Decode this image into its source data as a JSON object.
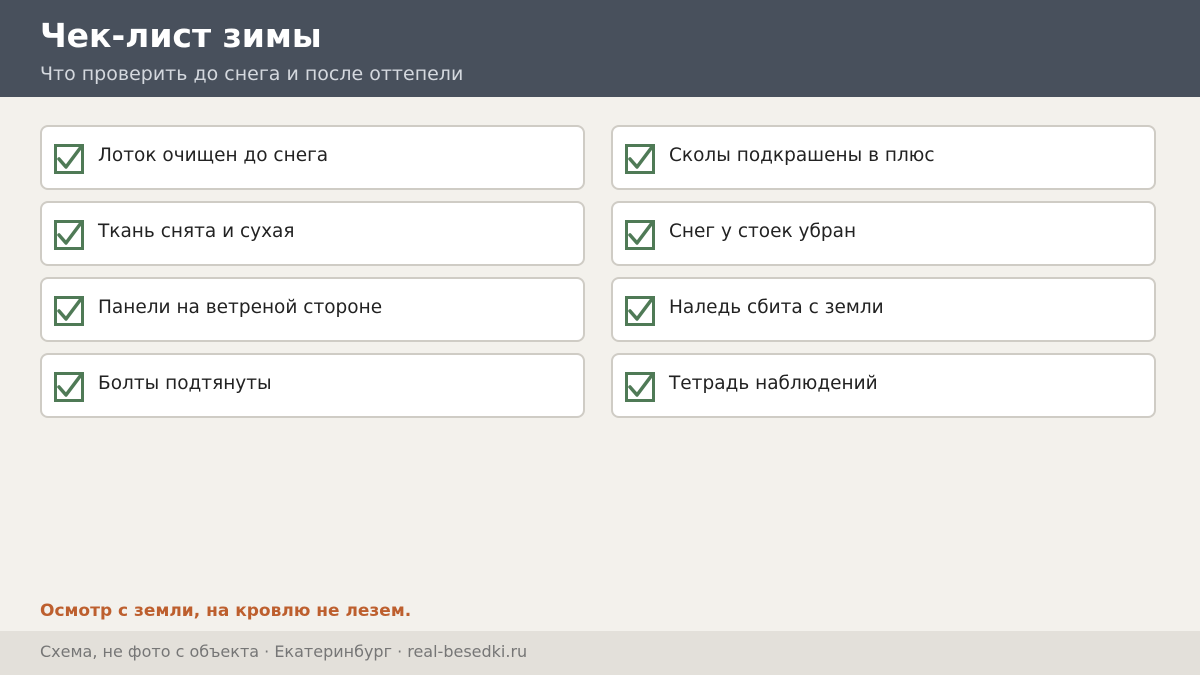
{
  "header": {
    "title": "Чек-лист зимы",
    "subtitle": "Что проверить до снега и после оттепели"
  },
  "checklist": {
    "items": [
      {
        "label": "Лоток очищен до снега",
        "checked": true
      },
      {
        "label": "Сколы подкрашены в плюс",
        "checked": true
      },
      {
        "label": "Ткань снята и сухая",
        "checked": true
      },
      {
        "label": "Снег у стоек убран",
        "checked": true
      },
      {
        "label": "Панели на ветреной стороне",
        "checked": true
      },
      {
        "label": "Наледь сбита с земли",
        "checked": true
      },
      {
        "label": "Болты подтянуты",
        "checked": true
      },
      {
        "label": "Тетрадь наблюдений",
        "checked": true
      }
    ]
  },
  "note": "Осмотр с земли, на кровлю не лезем.",
  "footer": {
    "text": "Схема, не фото с объекта  ·  Екатеринбург  ·  real-besedki.ru"
  },
  "colors": {
    "header_bg": "#48505c",
    "accent_orange": "#bd5f2e",
    "check_green": "#4f7a56"
  },
  "icons": {
    "checkbox": "checked-checkbox-icon"
  }
}
